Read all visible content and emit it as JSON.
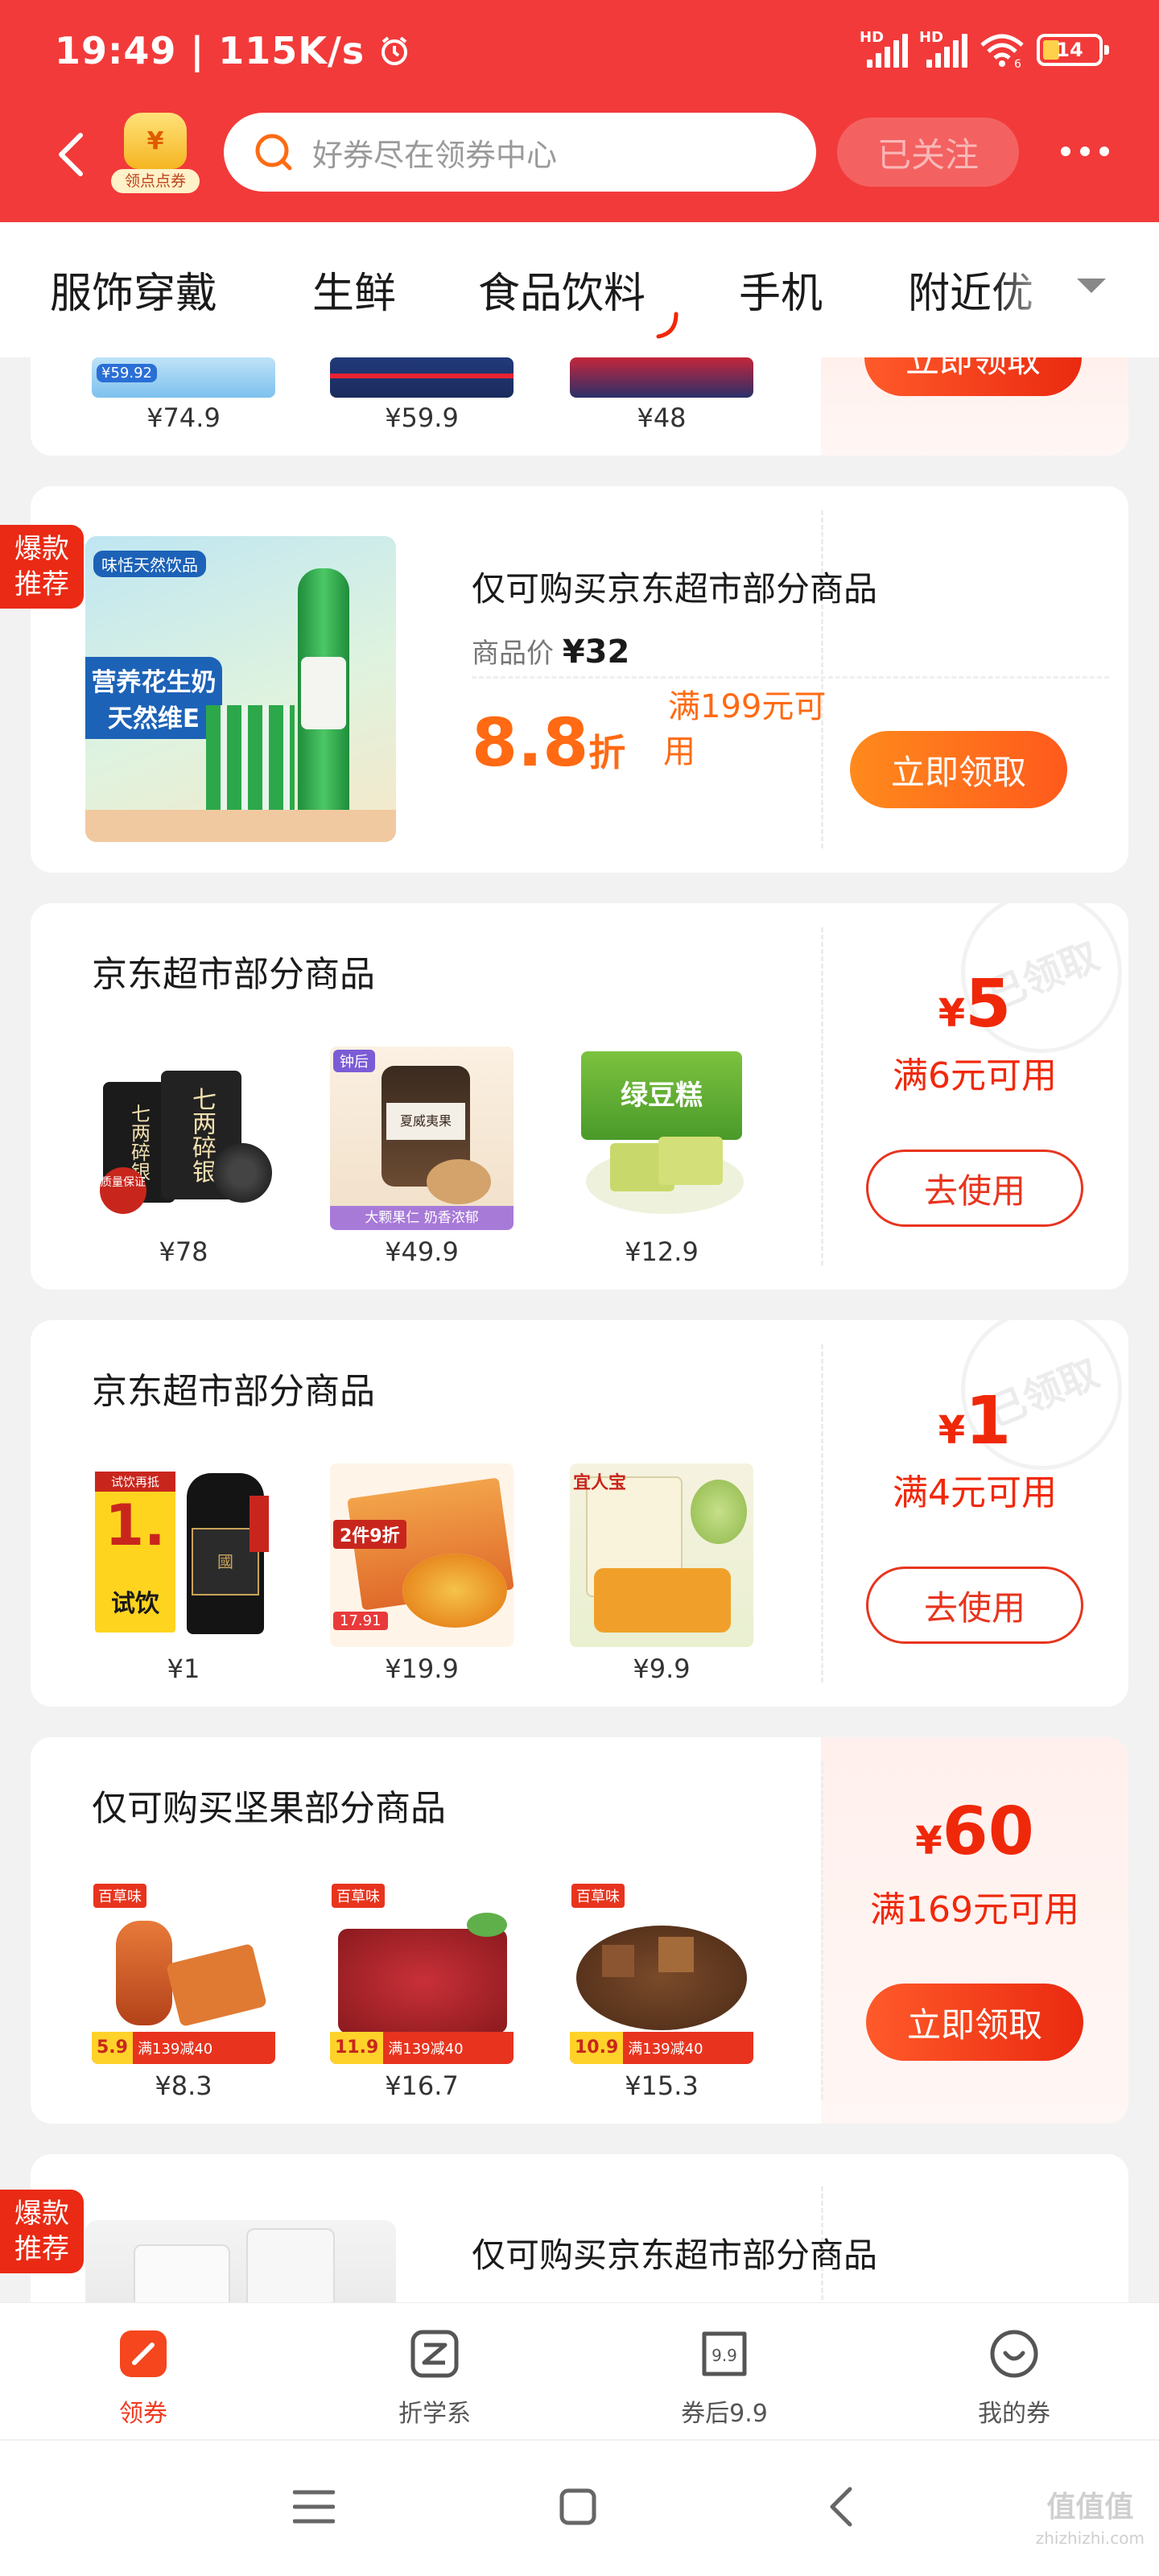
{
  "status_bar": {
    "time": "19:49",
    "speed": "115K/s",
    "network_1": "HD",
    "network_2": "HD",
    "wifi_label": "6",
    "battery": "14"
  },
  "header": {
    "badge_icon": "¥",
    "badge_label": "领点点券",
    "search_placeholder": "好券尽在领券中心",
    "follow_label": "已关注"
  },
  "categories": [
    "服饰穿戴",
    "生鲜",
    "食品饮料",
    "手机",
    "附近优"
  ],
  "active_category": "食品饮料",
  "top_partial_card": {
    "products": [
      {
        "price": "¥74.9",
        "tag": "¥59.92"
      },
      {
        "price": "¥59.9"
      },
      {
        "price": "¥48"
      }
    ],
    "button": "立即领取"
  },
  "featured_cards": [
    {
      "hot_tag": [
        "爆款",
        "推荐"
      ],
      "title": "仅可购买京东超市部分商品",
      "price_label": "商品价",
      "price": "¥32",
      "discount": "8.8",
      "discount_unit": "折",
      "condition_line1": "满199元可",
      "condition_line2": "用",
      "button": "立即领取",
      "image_brand": "味恬天然饮品",
      "image_text": [
        "营养花生奶",
        "天然维E"
      ]
    },
    {
      "hot_tag": [
        "爆款",
        "推荐"
      ],
      "title": "仅可购买京东超市部分商品"
    }
  ],
  "coupons": [
    {
      "title": "京东超市部分商品",
      "products": [
        {
          "price": "¥78",
          "img_text": "七两碎银",
          "badge": "质量保证"
        },
        {
          "price": "¥49.9",
          "img_text": "夏威夷果",
          "badge": "大颗果仁 奶香浓郁",
          "corner": "钟后"
        },
        {
          "price": "¥12.9",
          "img_text": "绿豆糕"
        }
      ],
      "amount": "5",
      "currency": "¥",
      "condition": "满6元可用",
      "button": "去使用",
      "stamp": "已领取"
    },
    {
      "title": "京东超市部分商品",
      "products": [
        {
          "price": "¥1",
          "img_text": "试饮",
          "badge": "试饮再抵",
          "big": "1."
        },
        {
          "price": "¥19.9",
          "img_text": "2件9折",
          "badge": "17.91"
        },
        {
          "price": "¥9.9",
          "img_text": "宜人宝"
        }
      ],
      "amount": "1",
      "currency": "¥",
      "condition": "满4元可用",
      "button": "去使用",
      "stamp": "已领取"
    },
    {
      "title": "仅可购买坚果部分商品",
      "products": [
        {
          "price": "¥8.3",
          "brand": "百草味",
          "tag_price": "5.9",
          "tag": "满139减40"
        },
        {
          "price": "¥16.7",
          "brand": "百草味",
          "tag_price": "11.9",
          "tag": "满139减40"
        },
        {
          "price": "¥15.3",
          "brand": "百草味",
          "tag_price": "10.9",
          "tag": "满139减40"
        }
      ],
      "amount": "60",
      "currency": "¥",
      "condition": "满169元可用",
      "button": "立即领取"
    }
  ],
  "tabbar": [
    {
      "label": "领券",
      "icon": "coupon-icon",
      "active": true
    },
    {
      "label": "折学系",
      "icon": "zhe-icon",
      "active": false
    },
    {
      "label": "券后9.9",
      "icon": "price-tag-icon",
      "active": false,
      "icon_text": "9.9"
    },
    {
      "label": "我的券",
      "icon": "smile-icon",
      "active": false
    }
  ],
  "watermark": {
    "title": "值值值",
    "url": "zhizhizhi.com"
  },
  "colors": {
    "brand_red": "#f23a3a",
    "coupon_red": "#f0280a",
    "discount_orange": "#ff6a13"
  }
}
